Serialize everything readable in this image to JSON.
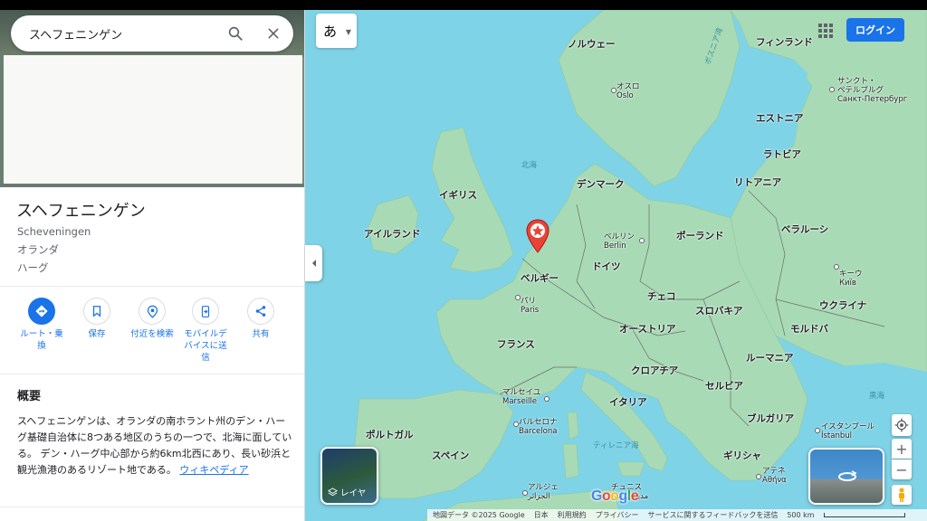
{
  "search": {
    "value": "スヘフェニンゲン"
  },
  "place": {
    "title": "スヘフェニンゲン",
    "latin_name": "Scheveningen",
    "country": "オランダ",
    "city": "ハーグ"
  },
  "actions": [
    {
      "label": "ルート・乗換",
      "icon": "directions-icon"
    },
    {
      "label": "保存",
      "icon": "bookmark-icon"
    },
    {
      "label": "付近を検索",
      "icon": "nearby-icon"
    },
    {
      "label": "モバイルデバイスに送信",
      "icon": "send-to-phone-icon"
    },
    {
      "label": "共有",
      "icon": "share-icon"
    }
  ],
  "overview": {
    "heading": "概要",
    "body": "スヘフェニンゲンは、オランダの南ホラント州のデン・ハーグ基礎自治体に8つある地区のうちの一つで、北海に面している。 デン・ハーグ中心部から約6km北西にあり、長い砂浜と観光漁港のあるリゾート地である。",
    "link": "ウィキペディア"
  },
  "map": {
    "ime_label": "あ",
    "login_label": "ログイン",
    "layers_label": "レイヤ",
    "google_logo": "Google",
    "countries": {
      "norway": "ノルウェー",
      "finland": "フィンランド",
      "estonia": "エストニア",
      "latvia": "ラトビア",
      "lithuania": "リトアニア",
      "denmark": "デンマーク",
      "uk": "イギリス",
      "ireland": "アイルランド",
      "belgium": "ベルギー",
      "germany": "ドイツ",
      "poland": "ポーランド",
      "belarus": "ベラルーシ",
      "ukraine": "ウクライナ",
      "czech": "チェコ",
      "slovakia": "スロバキア",
      "austria": "オーストリア",
      "moldova": "モルドバ",
      "france": "フランス",
      "romania": "ルーマニア",
      "croatia": "クロアチア",
      "serbia": "セルビア",
      "italy": "イタリア",
      "bulgaria": "ブルガリア",
      "portugal": "ポルトガル",
      "spain": "スペイン",
      "greece": "ギリシャ"
    },
    "cities": {
      "oslo_ja": "オスロ",
      "oslo": "Oslo",
      "stpete_ja": "サンクト・\nペテルブルグ",
      "stpete": "Санкт-Петербург",
      "berlin_ja": "ベルリン",
      "berlin": "Berlin",
      "kyiv_ja": "キーウ",
      "kyiv": "Київ",
      "paris_ja": "パリ",
      "paris": "Paris",
      "marseille_ja": "マルセイユ",
      "marseille": "Marseille",
      "barcelona_ja": "バルセロナ",
      "barcelona": "Barcelona",
      "istanbul_ja": "イスタンブール",
      "istanbul": "İstanbul",
      "athens_ja": "アテネ",
      "athens": "Αθήνα",
      "algiers_ja": "アルジェ",
      "algiers": "الجزائر",
      "tunis_ja": "チュニス",
      "tunis": "مدينة تونس"
    },
    "seas": {
      "north_sea": "北海",
      "bothnia": "ボスニア湾",
      "tyrrhenian": "ティレニア海",
      "black_sea": "黒海"
    },
    "footer": {
      "attribution": "地図データ ©2025 Google",
      "region": "日本",
      "terms": "利用規約",
      "privacy": "プライバシー",
      "feedback": "サービスに関するフィードバックを送信",
      "scale": "500 km"
    },
    "colors": {
      "land": "#a8dab5",
      "water": "#7fd3e6",
      "marker": "#ea4335",
      "accent": "#1a73e8"
    }
  }
}
